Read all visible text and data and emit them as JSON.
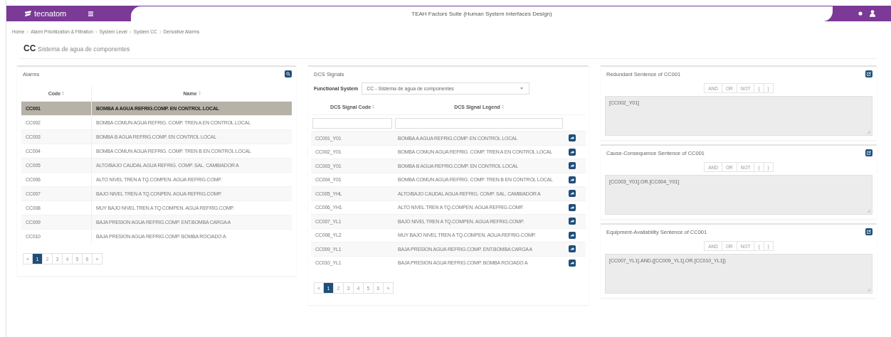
{
  "header": {
    "brand": "tecnatom",
    "title": "TEAH Factors Suite (Human System Interfaces Design)"
  },
  "breadcrumb": [
    "Home",
    "Alarm Prioritization & Filtration",
    "System Level",
    "System CC",
    "Derivative Alarms"
  ],
  "page_title": {
    "code": "CC",
    "name": "Sistema de agua de componentes"
  },
  "alarms": {
    "title": "Alarms",
    "columns": [
      "Code",
      "Name"
    ],
    "rows": [
      {
        "code": "CC001",
        "name": "BOMBA A AGUA REFRIG.COMP. EN CONTROL LOCAL",
        "selected": true
      },
      {
        "code": "CC002",
        "name": "BOMBA COMUN AGUA REFRIG. COMP. TREN A EN CONTROL LOCAL",
        "selected": false
      },
      {
        "code": "CC003",
        "name": "BOMBA B AGUA REFRIG.COMP. EN CONTROL LOCAL",
        "selected": false
      },
      {
        "code": "CC004",
        "name": "BOMBA COMUN AGUA REFRIG. COMP. TREN B EN CONTROL LOCAL",
        "selected": false
      },
      {
        "code": "CC005",
        "name": "ALTO/BAJO CAUDAL AGUA REFRIG. COMP. SAL. CAMBIADOR A",
        "selected": false
      },
      {
        "code": "CC006",
        "name": "ALTO NIVEL TREN A TQ.COMPEN. AGUA REFRIG.COMP.",
        "selected": false
      },
      {
        "code": "CC007",
        "name": "BAJO NIVEL TREN A TQ.CONPEN. AGUA REFRIG.COMP.",
        "selected": false
      },
      {
        "code": "CC008",
        "name": "MUY BAJO NIVEL TREN A TQ.COMPEN. AGUA REFRIG.COMP.",
        "selected": false
      },
      {
        "code": "CC009",
        "name": "BAJA PRESION AGUA REFRIG.COMP. ENT.BOMBA CARGA A",
        "selected": false
      },
      {
        "code": "CC010",
        "name": "BAJA PRESION AGUA REFRIG.COMP. BOMBA ROCIADO A",
        "selected": false
      }
    ],
    "pagination": [
      {
        "label": "«",
        "selected": false
      },
      {
        "label": "1",
        "selected": true
      },
      {
        "label": "2",
        "selected": false
      },
      {
        "label": "3",
        "selected": false
      },
      {
        "label": "4",
        "selected": false
      },
      {
        "label": "5",
        "selected": false
      },
      {
        "label": "6",
        "selected": false
      },
      {
        "label": "»",
        "selected": false
      }
    ]
  },
  "dcs": {
    "title": "DCS Signals",
    "filter_label": "Functional System",
    "filter_value": "CC - Sistema de agua de componentes",
    "columns": [
      "DCS Signal Code",
      "DCS Signal Legend"
    ],
    "rows": [
      {
        "code": "CC001_Y01",
        "legend": "BOMBA A AGUA REFRIG.COMP. EN CONTROL LOCAL"
      },
      {
        "code": "CC002_Y01",
        "legend": "BOMBA COMUN AGUA REFRIG. COMP. TREN A EN CONTROL LOCAL"
      },
      {
        "code": "CC003_Y01",
        "legend": "BOMBA B AGUA REFRIG.COMP. EN CONTROL LOCAL"
      },
      {
        "code": "CC004_Y01",
        "legend": "BOMBA COMUN AGUA REFRIG. COMP. TREN B EN CONTROL LOCAL"
      },
      {
        "code": "CC005_YHL",
        "legend": "ALTO/BAJO CAUDAL AGUA REFRIG. COMP. SAL. CAMBIADOR A"
      },
      {
        "code": "CC006_YH1",
        "legend": "ALTO NIVEL TREN A TQ.COMPEN. AGUA REFRIG.COMP."
      },
      {
        "code": "CC007_YL1",
        "legend": "BAJO NIVEL TREN A TQ.COMPEN. AGUA REFRIG.COMP."
      },
      {
        "code": "CC008_YL2",
        "legend": "MUY BAJO NIVEL TREN A TQ.COMPEN. AGUA REFRIG.COMP."
      },
      {
        "code": "CC009_YL1",
        "legend": "BAJA PRESION AGUA REFRIG.COMP. ENT.BOMBA CARGA A"
      },
      {
        "code": "CC010_YL1",
        "legend": "BAJA PRESION AGUA REFRIG.COMP. BOMBA ROCIADO A"
      }
    ],
    "pagination": [
      {
        "label": "«",
        "selected": false
      },
      {
        "label": "1",
        "selected": true
      },
      {
        "label": "2",
        "selected": false
      },
      {
        "label": "3",
        "selected": false
      },
      {
        "label": "4",
        "selected": false
      },
      {
        "label": "5",
        "selected": false
      },
      {
        "label": "6",
        "selected": false
      },
      {
        "label": "»",
        "selected": false
      }
    ]
  },
  "sentences": [
    {
      "title": "Redundant Sentence of CC001",
      "operators": [
        "AND",
        "OR",
        "NOT",
        "(",
        ")"
      ],
      "value": "[CC002_Y01]"
    },
    {
      "title": "Cause-Consequence Sentence of CC001",
      "operators": [
        "AND",
        "OR",
        "NOT",
        "(",
        ")"
      ],
      "value": "[CC003_Y01].OR.[CC004_Y01]"
    },
    {
      "title": "Equipment-Availability Sentence of CC001",
      "operators": [
        "AND",
        "OR",
        "NOT",
        "(",
        ")"
      ],
      "value": "[CC007_YL1].AND.([CC009_YL1].OR.[CC010_YL1])"
    }
  ]
}
